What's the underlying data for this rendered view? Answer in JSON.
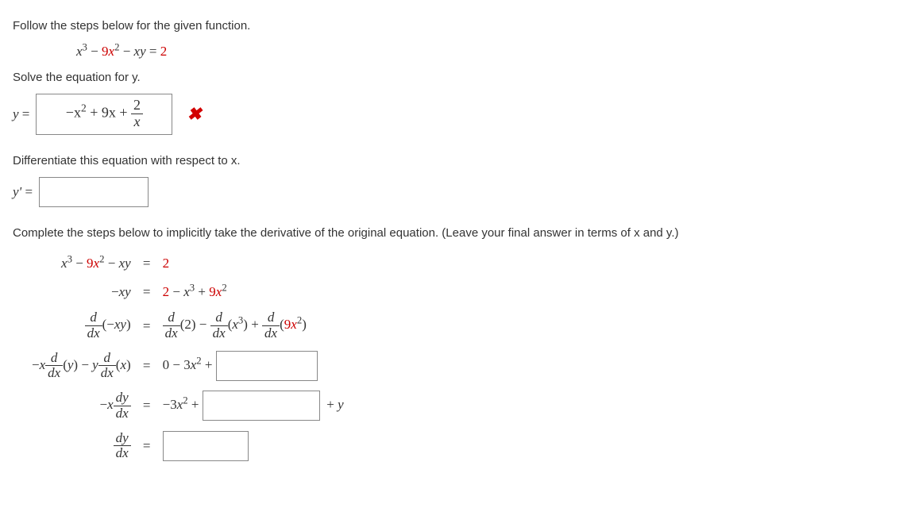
{
  "intro": "Follow the steps below for the given function.",
  "equation_display": "x³ − 9x² − xy = 2",
  "solve_prompt": "Solve the equation for y.",
  "y_label": "y =",
  "y_answer_entered": "−x² + 9x + 2⁄x",
  "diff_prompt": "Differentiate this equation with respect to x.",
  "yprime_label": "y' =",
  "implicit_prompt": "Complete the steps below to implicitly take the derivative of the original equation. (Leave your final answer in terms of x and y.)",
  "steps": {
    "s1_lhs": "x³ − 9x² − xy",
    "s1_rhs": "2",
    "s2_lhs": "−xy",
    "s2_rhs": "2 − x³ + 9x²",
    "s3_rhs_pre": "(2) −",
    "s3_rhs_mid": "(x³) +",
    "s3_rhs_end": "(9x²)",
    "s4_rhs_pre": "0 − 3x² +",
    "s5_rhs_pre": "−3x² +",
    "s5_rhs_post": "+ y"
  },
  "chart_data": {
    "type": "table",
    "title": "Implicit differentiation worked steps for x^3 - 9x^2 - xy = 2",
    "original_equation": "x^3 - 9x^2 - xy = 2",
    "coefficient_highlight": 9,
    "constant_rhs": 2,
    "solve_for_y_attempt": "-x^2 + 9x + 2/x",
    "solve_for_y_correct": false,
    "steps": [
      {
        "lhs": "x^3 - 9x^2 - xy",
        "rhs": "2"
      },
      {
        "lhs": "-xy",
        "rhs": "2 - x^3 + 9x^2"
      },
      {
        "lhs": "d/dx(-xy)",
        "rhs": "d/dx(2) - d/dx(x^3) + d/dx(9x^2)"
      },
      {
        "lhs": "-x * d/dx(y) - y * d/dx(x)",
        "rhs": "0 - 3x^2 + [blank]"
      },
      {
        "lhs": "-x * dy/dx",
        "rhs": "-3x^2 + [blank] + y"
      },
      {
        "lhs": "dy/dx",
        "rhs": "[blank]"
      }
    ],
    "blanks_count": 4
  }
}
